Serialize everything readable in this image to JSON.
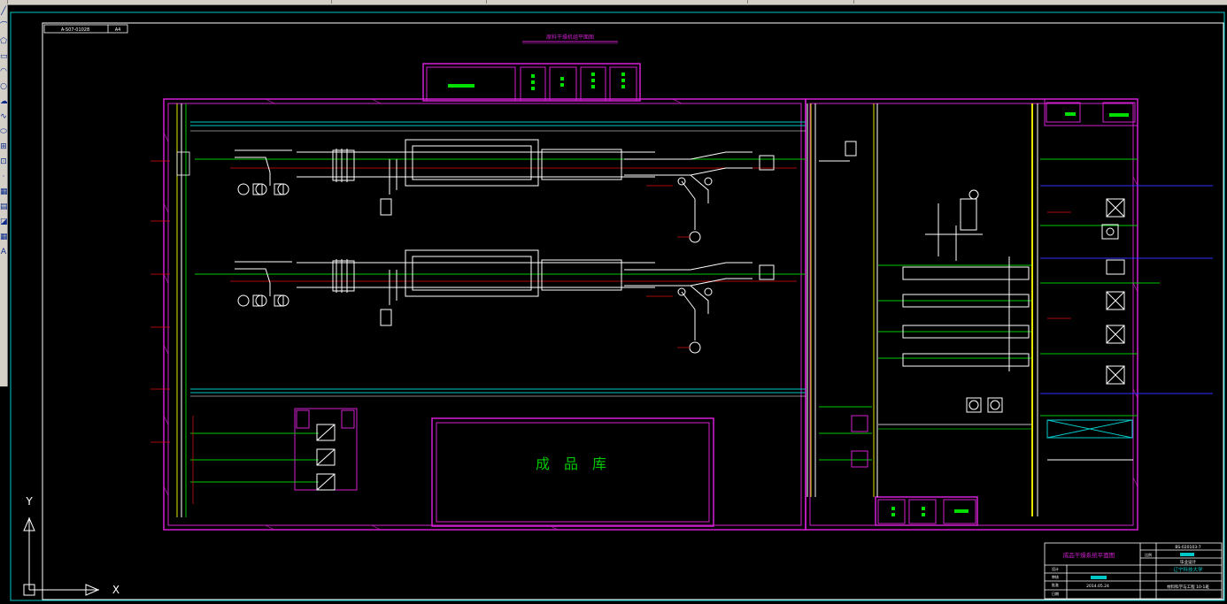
{
  "app": {
    "type": "cad-drawing-viewer",
    "background": "#000000"
  },
  "colors": {
    "wall": "#d21fd2",
    "equipment": "#ffffff",
    "pipe_green": "#00c800",
    "pipe_cyan": "#00c8c8",
    "pipe_yellow": "#e6e600",
    "pipe_red": "#e01010",
    "pipe_blue": "#3030ff",
    "frame": "#ffffff"
  },
  "toolbar": {
    "tools": [
      {
        "name": "line-tool",
        "glyph": "╱"
      },
      {
        "name": "polyline-tool",
        "glyph": "⌒"
      },
      {
        "name": "polygon-tool",
        "glyph": "⬠"
      },
      {
        "name": "rectangle-tool",
        "glyph": "▭"
      },
      {
        "name": "arc-tool",
        "glyph": "◠"
      },
      {
        "name": "circle-tool",
        "glyph": "○"
      },
      {
        "name": "revcloud-tool",
        "glyph": "☁"
      },
      {
        "name": "spline-tool",
        "glyph": "∿"
      },
      {
        "name": "ellipse-tool",
        "glyph": "⬭"
      },
      {
        "name": "insert-block-tool",
        "glyph": "⊞"
      },
      {
        "name": "make-block-tool",
        "glyph": "⊡"
      },
      {
        "name": "point-tool",
        "glyph": "·"
      },
      {
        "name": "hatch-tool",
        "glyph": "▦"
      },
      {
        "name": "gradient-tool",
        "glyph": "▤"
      },
      {
        "name": "region-tool",
        "glyph": "◪"
      },
      {
        "name": "table-tool",
        "glyph": "▦"
      },
      {
        "name": "mtext-tool",
        "glyph": "A"
      }
    ]
  },
  "drawing": {
    "sheet_code": "A-S07-01028",
    "sheet_tag": "A4",
    "plan_title": "原料干燥机组平面图",
    "warehouse_label": "成　品　库",
    "ucs": {
      "y_label": "Y",
      "x_label": "X"
    }
  },
  "title_block": {
    "drawing_name": "成品干燥系统平面图",
    "drawing_number": "BS-020103-7",
    "scale_label": "比例",
    "design_stage": "毕业设计",
    "university": "辽宁科技大学",
    "date": "2014.05.24",
    "class_name": "材料科学与工程 10-1班",
    "designer_label": "设计",
    "checker_label": "审核",
    "approver_label": "批准",
    "date_label": "日期"
  }
}
